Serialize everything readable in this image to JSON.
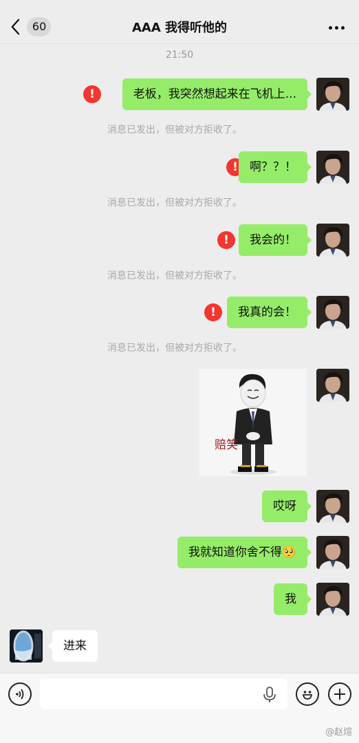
{
  "header": {
    "unread_count": "60",
    "title": "AAA 我得听他的"
  },
  "chat": {
    "time": "21:50",
    "rejected_notice": "消息已发出，但被对方拒收了。",
    "messages": [
      {
        "from": "me",
        "text": "老板，我突然想起来在飞机上...",
        "failed": true
      },
      {
        "from": "me",
        "text": "啊？？！",
        "failed": true
      },
      {
        "from": "me",
        "text": "我会的！",
        "failed": true
      },
      {
        "from": "me",
        "text": "我真的会！",
        "failed": true
      },
      {
        "from": "me",
        "type": "sticker",
        "text": "赔笑"
      },
      {
        "from": "me",
        "text": "哎呀"
      },
      {
        "from": "me",
        "text": "我就知道你舍不得🥺"
      },
      {
        "from": "me",
        "text": "我"
      },
      {
        "from": "other",
        "text": "进来"
      }
    ],
    "error_icon": "!"
  },
  "input_bar": {
    "placeholder": "",
    "voice_icon": "voice-icon",
    "emoji_icon": "emoji-icon",
    "plus_icon": "plus-icon"
  },
  "watermark": "@赵煊",
  "colors": {
    "background": "#ededed",
    "my_bubble": "#95ec69",
    "other_bubble": "#ffffff",
    "error": "#f43530"
  }
}
